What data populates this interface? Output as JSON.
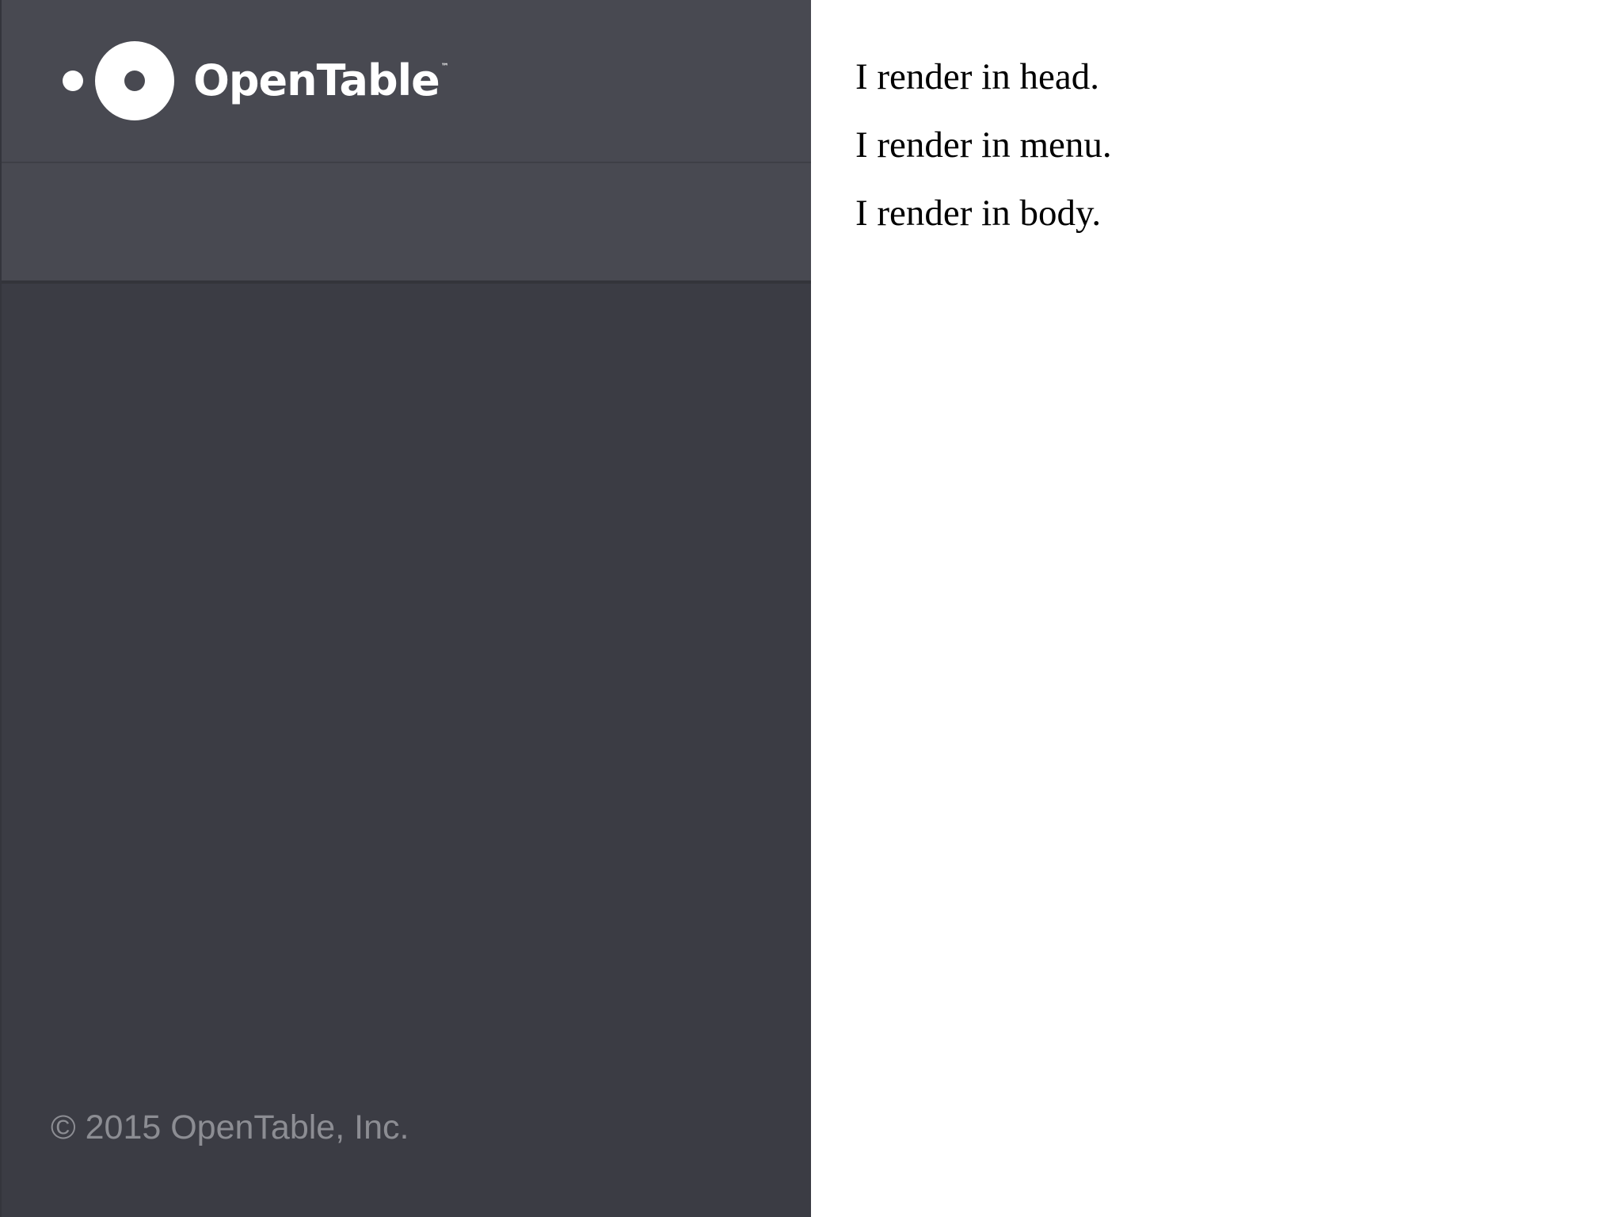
{
  "sidebar": {
    "logo": {
      "text": "OpenTable",
      "trademark": "™",
      "icon": "opentable-logo-icon"
    },
    "footer": {
      "copyright": "© 2015 OpenTable, Inc."
    },
    "colors": {
      "background": "#3b3c44",
      "header": "#484951",
      "footer_text": "#8c8d93"
    }
  },
  "main": {
    "lines": [
      "I render in head.",
      "I render in menu.",
      "I render in body."
    ]
  }
}
